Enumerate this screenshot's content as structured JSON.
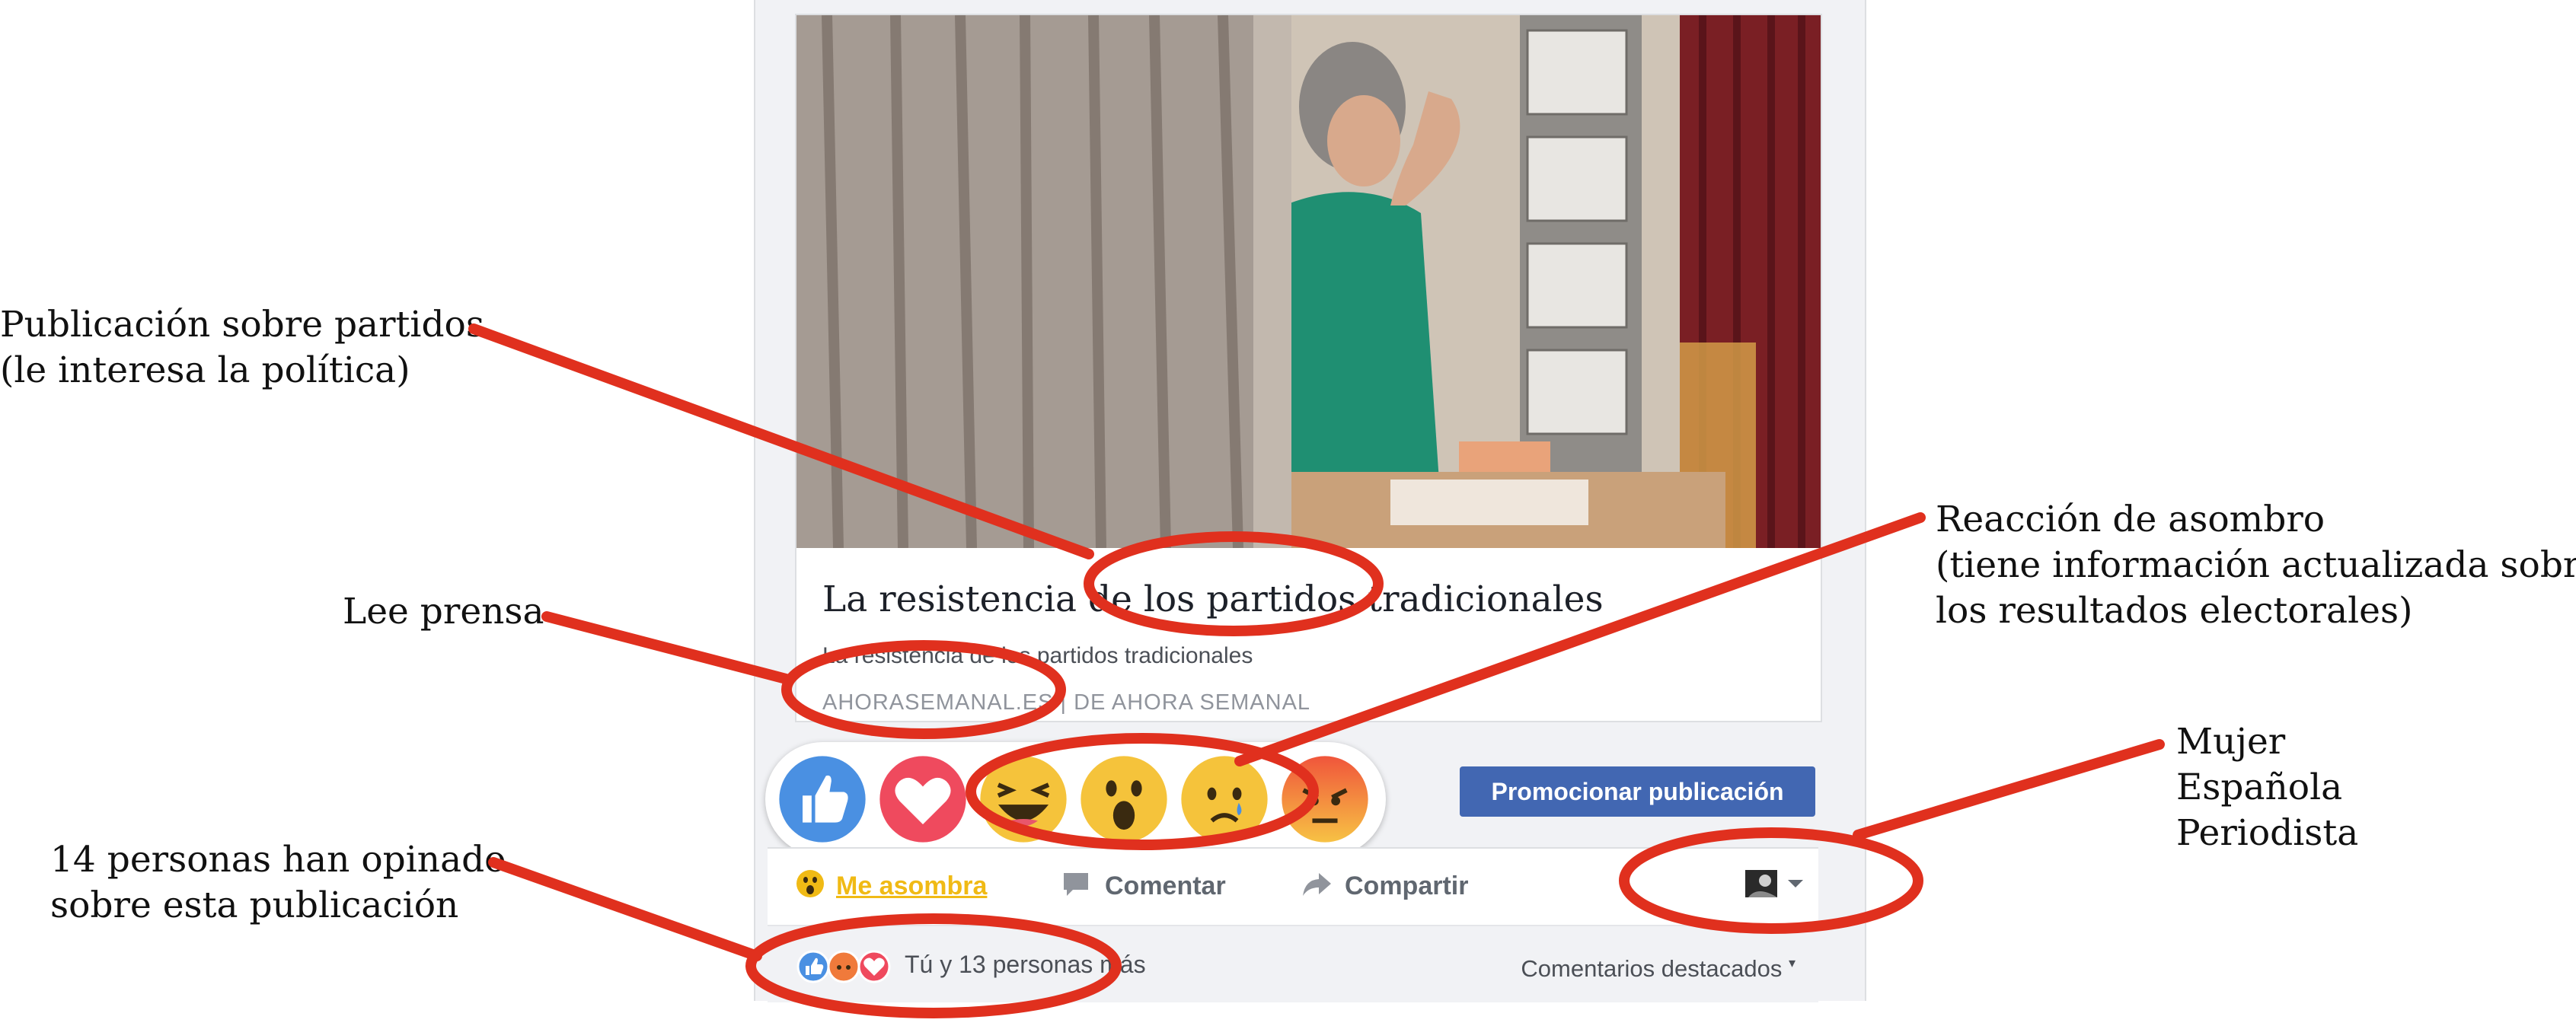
{
  "annotations": {
    "partidos_line1": "Publicación sobre partidos",
    "partidos_line2": "(le interesa la política)",
    "prensa": "Lee prensa",
    "personas_line1": "14 personas han opinado",
    "personas_line2": "sobre esta publicación",
    "asombro_line1": "Reacción de asombro",
    "asombro_line2": "(tiene información actualizada sobre",
    "asombro_line3": "los resultados electorales)",
    "perfil_line1": "Mujer",
    "perfil_line2": "Española",
    "perfil_line3": "Periodista"
  },
  "link_preview": {
    "title": "La resistencia de los partidos tradicionales",
    "description": "La resistencia de los partidos tradicionales",
    "source": "AHORASEMANAL.ES | DE AHORA SEMANAL"
  },
  "reactions": [
    "like-icon",
    "love-icon",
    "haha-icon",
    "wow-icon",
    "sad-icon",
    "angry-icon"
  ],
  "promote_button": "Promocionar publicación",
  "actions": {
    "reacted": "Me asombra",
    "comment": "Comentar",
    "share": "Compartir"
  },
  "summary": {
    "reactions_text": "Tú y 13 personas más",
    "sort_label": "Comentarios destacados"
  },
  "colors": {
    "facebook_blue": "#4267b2",
    "wow_yellow": "#f0ba15",
    "annotation_red": "#e0301e"
  }
}
